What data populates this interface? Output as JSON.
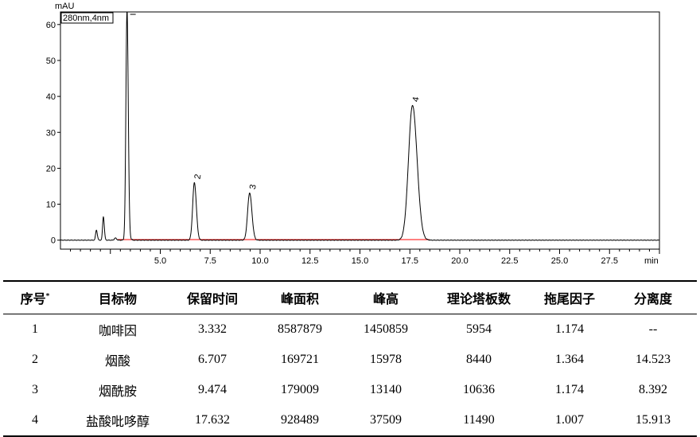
{
  "chart_data": {
    "type": "line",
    "xlabel": "min",
    "ylabel": "mAU",
    "signal_label": "280nm,4nm",
    "xlim": [
      0,
      30
    ],
    "ylim": [
      -2.5,
      63.5
    ],
    "x_ticks": [
      5.0,
      7.5,
      10.0,
      12.5,
      15.0,
      17.5,
      20.0,
      22.5,
      25.0,
      27.5
    ],
    "x_tick_labels": [
      "5.0",
      "7.5",
      "10.0",
      "12.5",
      "15.0",
      "17.5",
      "20.0",
      "22.5",
      "25.0",
      "27.5"
    ],
    "y_ticks": [
      0,
      10,
      20,
      30,
      40,
      50,
      60
    ],
    "y_tick_labels": [
      "0",
      "10",
      "20",
      "30",
      "40",
      "50",
      "60"
    ],
    "grid": false,
    "baseline": {
      "color": "#ff0000"
    },
    "line_color": "#000000",
    "peaks": [
      {
        "label": "",
        "rt": 1.8,
        "height": 2.8,
        "width": 0.04
      },
      {
        "label": "",
        "rt": 2.15,
        "height": 6.5,
        "width": 0.04
      },
      {
        "label": "",
        "rt": 2.75,
        "height": 0.6,
        "width": 0.05
      },
      {
        "label": "1",
        "rt": 3.332,
        "height": 63.5,
        "width": 0.055,
        "offscale": true
      },
      {
        "label": "2",
        "rt": 6.707,
        "height": 16.0,
        "width": 0.085
      },
      {
        "label": "3",
        "rt": 9.474,
        "height": 13.14,
        "width": 0.1
      },
      {
        "label": "4",
        "rt": 17.632,
        "height": 37.51,
        "width": 0.2
      }
    ]
  },
  "table": {
    "headers": [
      "序号",
      "目标物",
      "保留时间",
      "峰面积",
      "峰高",
      "理论塔板数",
      "拖尾因子",
      "分离度"
    ],
    "header_mark": "*",
    "rows": [
      [
        "1",
        "咖啡因",
        "3.332",
        "8587879",
        "1450859",
        "5954",
        "1.174",
        "--"
      ],
      [
        "2",
        "烟酸",
        "6.707",
        "169721",
        "15978",
        "8440",
        "1.364",
        "14.523"
      ],
      [
        "3",
        "烟酰胺",
        "9.474",
        "179009",
        "13140",
        "10636",
        "1.174",
        "8.392"
      ],
      [
        "4",
        "盐酸吡哆醇",
        "17.632",
        "928489",
        "37509",
        "11490",
        "1.007",
        "15.913"
      ]
    ]
  }
}
